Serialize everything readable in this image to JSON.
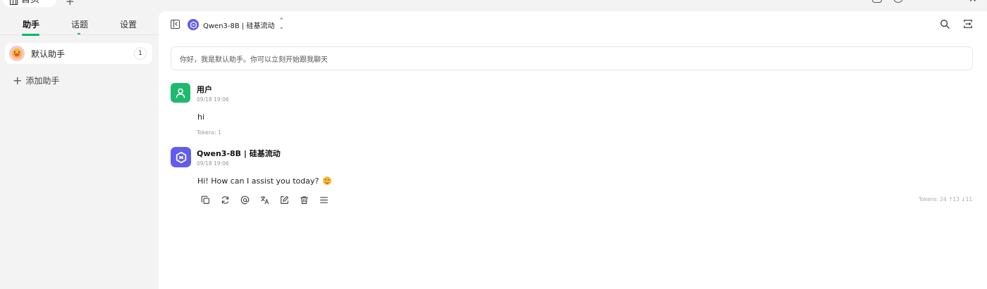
{
  "window": {
    "home_tab_label": "首页",
    "add_tab_label": "+"
  },
  "sidebar": {
    "tabs": [
      {
        "label": "助手",
        "active": true
      },
      {
        "label": "话题",
        "active": false
      },
      {
        "label": "设置",
        "active": false
      }
    ],
    "assistants": [
      {
        "name": "默认助手",
        "count": "1"
      }
    ],
    "add_assistant_label": "添加助手"
  },
  "header": {
    "model_name": "Qwen3-8B | 硅基流动",
    "chevron": "⌃⌄"
  },
  "main": {
    "prompt_text": "你好，我是默认助手。你可以立刻开始跟我聊天",
    "messages": [
      {
        "sender": "用户",
        "time": "09/18 19:06",
        "text": "hi",
        "tokens": "Tokens: 1"
      },
      {
        "sender": "Qwen3-8B | 硅基流动",
        "time": "09/18 19:06",
        "text": "Hi! How can I assist you today?",
        "tokens": "Tokens: 24 ↑13 ↓11"
      }
    ]
  },
  "colors": {
    "accent": "#00b96b",
    "user_avatar": "#1fb970",
    "model_logo": "#615ced",
    "sidebar_bg": "#f3f3f4"
  }
}
